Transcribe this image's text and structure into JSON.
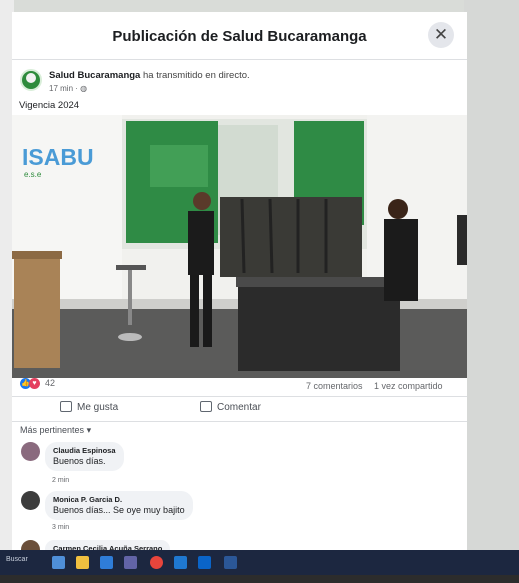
{
  "modal": {
    "title": "Publicación de Salud Bucaramanga",
    "close_icon": "close-icon"
  },
  "post": {
    "author": "Salud Bucaramanga",
    "action_text": "ha transmitido en directo.",
    "time": "17 min ·",
    "privacy_icon": "globe-icon",
    "caption": "Vigencia 2024",
    "video_logo_text": "ISABU",
    "video_logo_subtext": "e.s.e"
  },
  "stats": {
    "reactions_count": "42",
    "comments": "7 comentarios",
    "shares": "1 vez compartido"
  },
  "actions": {
    "like_label": "Me gusta",
    "comment_label": "Comentar"
  },
  "comments_section": {
    "sort_label": "Más pertinentes"
  },
  "comments": [
    {
      "author": "Claudia Espinosa",
      "text": "Buenos días.",
      "time": "2 min"
    },
    {
      "author": "Monica P. Garcia D.",
      "text": "Buenos días... Se oye muy bajito",
      "time": "3 min"
    },
    {
      "author": "Carmen Cecilia Acuña Serrano",
      "text": "",
      "time": ""
    }
  ],
  "taskbar": {
    "search_text": "Buscar",
    "icons": [
      "widgets-icon",
      "file-explorer-icon",
      "store-icon",
      "teams-icon",
      "chrome-icon",
      "onedrive-icon",
      "outlook-icon",
      "word-icon"
    ]
  },
  "colors": {
    "facebook_blue": "#1877f2",
    "isabu_green": "#2e8b3c",
    "taskbar": "#1c2740"
  }
}
